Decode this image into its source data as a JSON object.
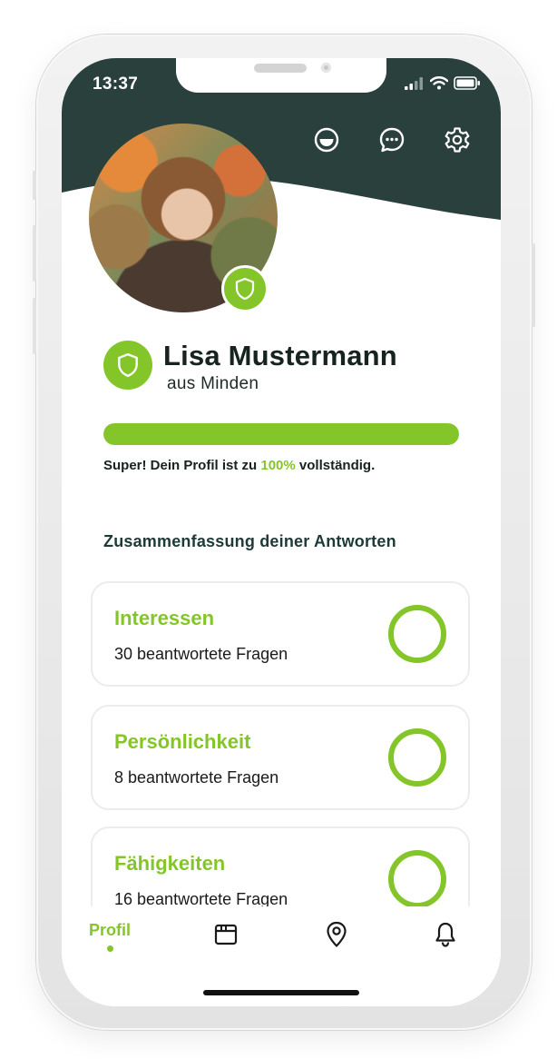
{
  "status_bar": {
    "time": "13:37"
  },
  "header": {
    "icons": [
      "face-icon",
      "chat-icon",
      "gear-icon"
    ],
    "background_color": "#2a403d"
  },
  "profile": {
    "name": "Lisa Mustermann",
    "location": "aus Minden",
    "completion_percent": 100,
    "completion_prefix": "Super! Dein Profil ist zu ",
    "completion_value": "100%",
    "completion_suffix": " vollständig."
  },
  "summary": {
    "title": "Zusammenfassung deiner Antworten",
    "cards": [
      {
        "title": "Interessen",
        "subtitle": "30 beantwortete Fragen"
      },
      {
        "title": "Persönlichkeit",
        "subtitle": "8 beantwortete Fragen"
      },
      {
        "title": "Fähigkeiten",
        "subtitle": "16 beantwortete Fragen"
      }
    ]
  },
  "tabbar": {
    "active_label": "Profil",
    "icons": [
      "browser-icon",
      "location-pin-icon",
      "bell-icon"
    ]
  },
  "colors": {
    "accent": "#84c62a",
    "dark": "#2a403d",
    "text": "#16231f"
  }
}
